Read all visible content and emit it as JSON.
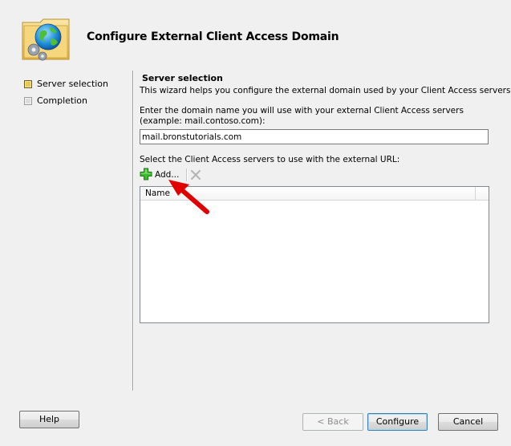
{
  "wizard": {
    "title": "Configure External Client Access Domain",
    "icon": "globe-gears-folder-icon"
  },
  "steps": [
    {
      "label": "Server selection",
      "state": "active"
    },
    {
      "label": "Completion",
      "state": "inactive"
    }
  ],
  "main": {
    "section_title": "Server selection",
    "description": "This wizard helps you configure the external domain used by your Client Access servers.",
    "domain_label": "Enter the domain name you will use with your external Client Access servers (example: mail.contoso.com):",
    "domain_value": "mail.bronstutorials.com",
    "servers_label": "Select the Client Access servers to use with the external URL:",
    "toolbar": {
      "add_label": "Add...",
      "add_icon": "green-plus-icon",
      "remove_icon": "remove-x-icon"
    },
    "list": {
      "columns": [
        "Name"
      ],
      "rows": []
    }
  },
  "buttons": {
    "help": "Help",
    "back": "< Back",
    "configure": "Configure",
    "cancel": "Cancel"
  },
  "colors": {
    "window_bg": "#f0f0f0",
    "active_step": "#e8c84a",
    "arrow": "#e00000",
    "add_icon": "#3dbb2f"
  }
}
